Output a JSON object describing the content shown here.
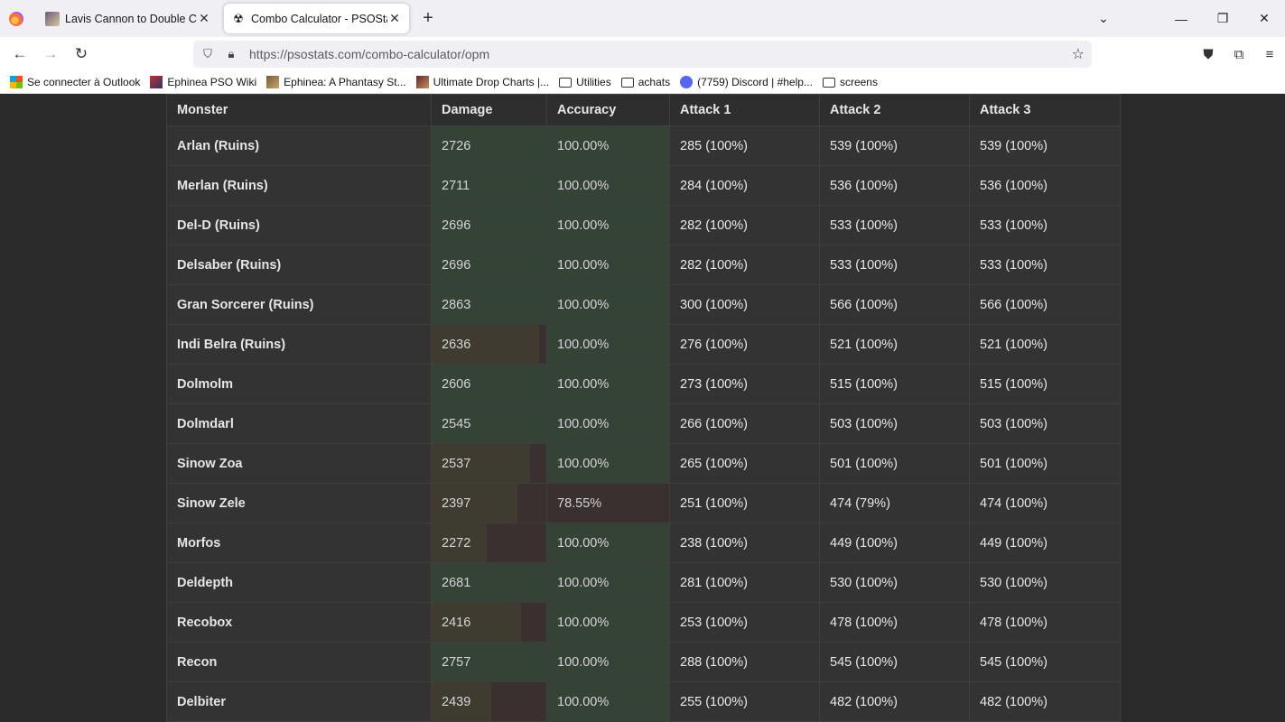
{
  "browser": {
    "tabs": [
      {
        "title": "Lavis Cannon to Double Cannon",
        "active": false
      },
      {
        "title": "Combo Calculator - PSOStats",
        "active": true
      }
    ],
    "url": "https://psostats.com/combo-calculator/opm",
    "bookmarks": [
      {
        "label": "Se connecter à Outlook",
        "icon": "microsoft-icon"
      },
      {
        "label": "Ephinea PSO Wiki",
        "icon": "site-icon"
      },
      {
        "label": "Ephinea: A Phantasy St...",
        "icon": "site-icon"
      },
      {
        "label": "Ultimate Drop Charts |...",
        "icon": "site-icon"
      },
      {
        "label": "Utilities",
        "icon": "folder-icon"
      },
      {
        "label": "achats",
        "icon": "folder-icon"
      },
      {
        "label": "(7759) Discord | #help...",
        "icon": "discord-icon"
      },
      {
        "label": "screens",
        "icon": "folder-icon"
      }
    ]
  },
  "table": {
    "headers": [
      "Monster",
      "Damage",
      "Accuracy",
      "Attack 1",
      "Attack 2",
      "Attack 3"
    ],
    "damage_max": 2863,
    "rows": [
      {
        "monster": "Arlan (Ruins)",
        "damage": "2726",
        "damage_fill": 1.0,
        "accuracy": "100.00%",
        "accuracy_fill": 1.0,
        "a1": "285 (100%)",
        "a2": "539 (100%)",
        "a3": "539 (100%)"
      },
      {
        "monster": "Merlan (Ruins)",
        "damage": "2711",
        "damage_fill": 1.0,
        "accuracy": "100.00%",
        "accuracy_fill": 1.0,
        "a1": "284 (100%)",
        "a2": "536 (100%)",
        "a3": "536 (100%)"
      },
      {
        "monster": "Del-D (Ruins)",
        "damage": "2696",
        "damage_fill": 1.0,
        "accuracy": "100.00%",
        "accuracy_fill": 1.0,
        "a1": "282 (100%)",
        "a2": "533 (100%)",
        "a3": "533 (100%)"
      },
      {
        "monster": "Delsaber (Ruins)",
        "damage": "2696",
        "damage_fill": 1.0,
        "accuracy": "100.00%",
        "accuracy_fill": 1.0,
        "a1": "282 (100%)",
        "a2": "533 (100%)",
        "a3": "533 (100%)"
      },
      {
        "monster": "Gran Sorcerer (Ruins)",
        "damage": "2863",
        "damage_fill": 1.0,
        "accuracy": "100.00%",
        "accuracy_fill": 1.0,
        "a1": "300 (100%)",
        "a2": "566 (100%)",
        "a3": "566 (100%)"
      },
      {
        "monster": "Indi Belra (Ruins)",
        "damage": "2636",
        "damage_fill": 0.94,
        "accuracy": "100.00%",
        "accuracy_fill": 1.0,
        "a1": "276 (100%)",
        "a2": "521 (100%)",
        "a3": "521 (100%)"
      },
      {
        "monster": "Dolmolm",
        "damage": "2606",
        "damage_fill": 1.0,
        "accuracy": "100.00%",
        "accuracy_fill": 1.0,
        "a1": "273 (100%)",
        "a2": "515 (100%)",
        "a3": "515 (100%)"
      },
      {
        "monster": "Dolmdarl",
        "damage": "2545",
        "damage_fill": 1.0,
        "accuracy": "100.00%",
        "accuracy_fill": 1.0,
        "a1": "266 (100%)",
        "a2": "503 (100%)",
        "a3": "503 (100%)"
      },
      {
        "monster": "Sinow Zoa",
        "damage": "2537",
        "damage_fill": 0.86,
        "accuracy": "100.00%",
        "accuracy_fill": 1.0,
        "a1": "265 (100%)",
        "a2": "501 (100%)",
        "a3": "501 (100%)"
      },
      {
        "monster": "Sinow Zele",
        "damage": "2397",
        "damage_fill": 0.75,
        "accuracy": "78.55%",
        "accuracy_fill": 0.0,
        "a1": "251 (100%)",
        "a2": "474 (79%)",
        "a3": "474 (100%)"
      },
      {
        "monster": "Morfos",
        "damage": "2272",
        "damage_fill": 0.48,
        "accuracy": "100.00%",
        "accuracy_fill": 1.0,
        "a1": "238 (100%)",
        "a2": "449 (100%)",
        "a3": "449 (100%)"
      },
      {
        "monster": "Deldepth",
        "damage": "2681",
        "damage_fill": 1.0,
        "accuracy": "100.00%",
        "accuracy_fill": 1.0,
        "a1": "281 (100%)",
        "a2": "530 (100%)",
        "a3": "530 (100%)"
      },
      {
        "monster": "Recobox",
        "damage": "2416",
        "damage_fill": 0.78,
        "accuracy": "100.00%",
        "accuracy_fill": 1.0,
        "a1": "253 (100%)",
        "a2": "478 (100%)",
        "a3": "478 (100%)"
      },
      {
        "monster": "Recon",
        "damage": "2757",
        "damage_fill": 1.0,
        "accuracy": "100.00%",
        "accuracy_fill": 1.0,
        "a1": "288 (100%)",
        "a2": "545 (100%)",
        "a3": "545 (100%)"
      },
      {
        "monster": "Delbiter",
        "damage": "2439",
        "damage_fill": 0.52,
        "accuracy": "100.00%",
        "accuracy_fill": 1.0,
        "a1": "255 (100%)",
        "a2": "482 (100%)",
        "a3": "482 (100%)"
      }
    ]
  },
  "colors": {
    "page_bg": "#2b2b2b",
    "cell_bg": "#333333",
    "bar_good": "#354236",
    "bar_warn": "#3f3b30",
    "bar_bad": "#3b3030"
  }
}
